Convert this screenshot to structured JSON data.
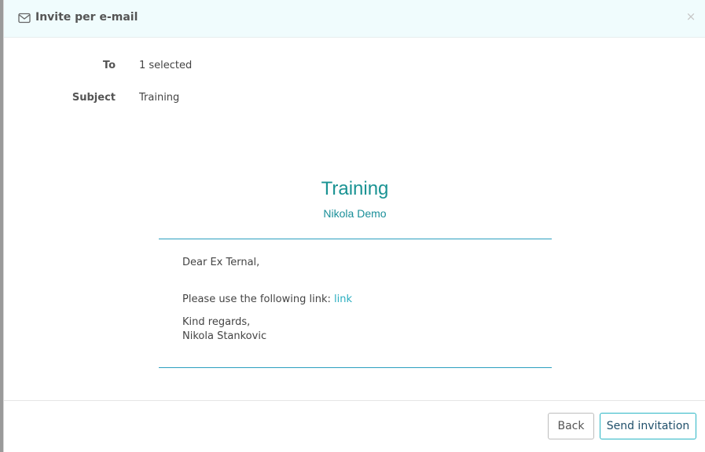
{
  "dialog": {
    "title": "Invite per e-mail",
    "close_glyph": "×"
  },
  "fields": {
    "to_label": "To",
    "to_value": "1 selected",
    "subject_label": "Subject",
    "subject_value": "Training"
  },
  "preview": {
    "title": "Training",
    "subtitle": "Nikola Demo",
    "greeting": "Dear Ex Ternal,",
    "link_intro": "Please use the following link: ",
    "link_text": "link",
    "closing": "Kind regards,",
    "signature": "Nikola Stankovic"
  },
  "footer": {
    "back_label": "Back",
    "send_label": "Send invitation"
  },
  "colors": {
    "accent": "#1a9393",
    "link": "#2aaec0",
    "header_bg": "#f0fcfd"
  },
  "icons": {
    "header": "envelope-icon",
    "close": "close-icon"
  }
}
